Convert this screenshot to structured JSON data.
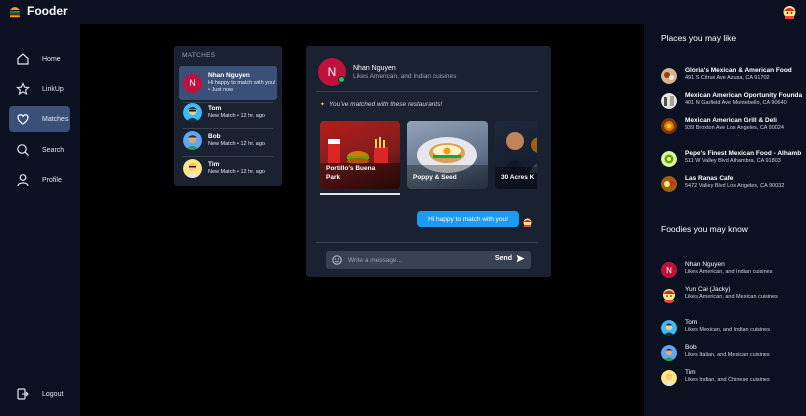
{
  "app": {
    "title": "Fooder"
  },
  "nav": {
    "items": [
      {
        "label": "Home",
        "icon": "home-icon"
      },
      {
        "label": "LinkUp",
        "icon": "star-icon"
      },
      {
        "label": "Matches",
        "icon": "heart-icon",
        "active": true
      },
      {
        "label": "Search",
        "icon": "search-icon"
      },
      {
        "label": "Profile",
        "icon": "person-icon"
      }
    ],
    "logout": "Logout"
  },
  "matches": {
    "title": "MATCHES",
    "items": [
      {
        "name": "Nhan Nguyen",
        "sub": "Hi happy to match with you! • Just now",
        "initial": "N"
      },
      {
        "name": "Tom",
        "sub": "New Match • 12 hr. ago"
      },
      {
        "name": "Bob",
        "sub": "New Match • 12 hr. ago"
      },
      {
        "name": "Tim",
        "sub": "New Match • 12 hr. ago"
      }
    ]
  },
  "chat": {
    "initial": "N",
    "name": "Nhan Nguyen",
    "likes": "Likes American, and Indian cuisines",
    "matched_note": "You've matched with these restaurants!",
    "restaurants": [
      {
        "name": "Portillo's Buena Park"
      },
      {
        "name": "Poppy & Seed"
      },
      {
        "name": "30 Acres K"
      }
    ],
    "message": "Hi happy to match with you!",
    "composer_placeholder": "Write a message...",
    "send_label": "Send"
  },
  "places": {
    "title": "Places you may like",
    "items": [
      {
        "name": "Gloria's Mexican & American Food",
        "address": "491 S Citrus Ave Azusa, CA 91702"
      },
      {
        "name": "Mexican American Oportunity Founda",
        "address": "401 N Garfield Ave Montebello, CA 90640"
      },
      {
        "name": "Mexican American Grill & Deli",
        "address": "939 Broxton Ave Los Angeles, CA 90024"
      },
      {
        "name": "Pepe's Finest Mexican Food - Alhamb",
        "address": "511 W Valley Blvd Alhambra, CA 91803"
      },
      {
        "name": "Las Ranas Cafe",
        "address": "5472 Valley Blvd Los Angeles, CA 90032"
      }
    ]
  },
  "foodies": {
    "title": "Foodies you may know",
    "items": [
      {
        "name": "Nhan Nguyen",
        "likes": "Likes American, and Indian cuisines",
        "initial": "N"
      },
      {
        "name": "Yun Cai (Jacky)",
        "likes": "Likes American, and Mexican cuisines"
      },
      {
        "name": "Tom",
        "likes": "Likes Mexican, and Indian cuisines"
      },
      {
        "name": "Bob",
        "likes": "Likes Italian, and Mexican cuisines"
      },
      {
        "name": "Tim",
        "likes": "Likes Indian, and Chinese cuisines"
      }
    ]
  },
  "colors": {
    "background": "#000000",
    "panel": "#0b1120",
    "card": "#1a2232",
    "active": "#3b5078",
    "accent_blue": "#1d9bf0",
    "avatar_red": "#be123c",
    "online": "#22c55e"
  }
}
